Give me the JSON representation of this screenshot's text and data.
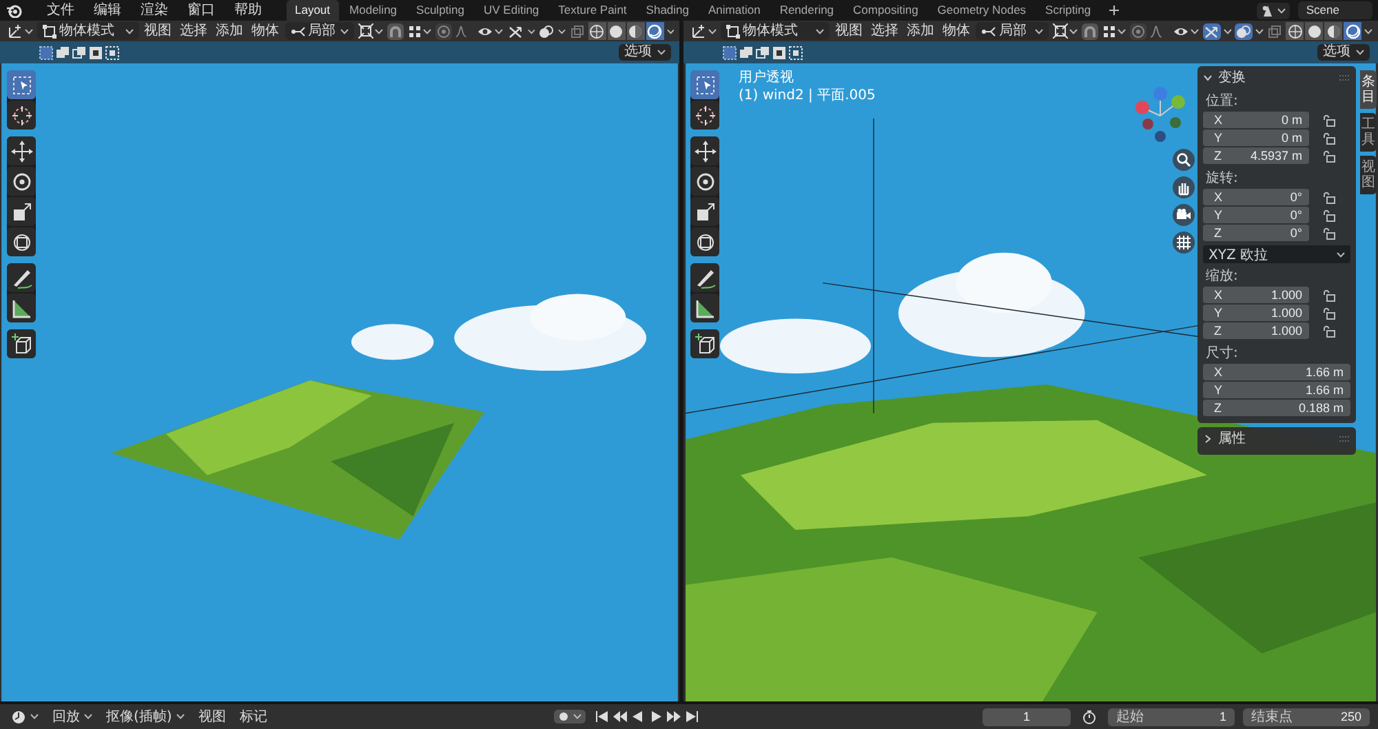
{
  "topbar": {
    "menus": [
      "文件",
      "编辑",
      "渲染",
      "窗口",
      "帮助"
    ],
    "workspaces": [
      {
        "label": "Layout",
        "selected": true
      },
      {
        "label": "Modeling",
        "selected": false
      },
      {
        "label": "Sculpting",
        "selected": false
      },
      {
        "label": "UV Editing",
        "selected": false
      },
      {
        "label": "Texture Paint",
        "selected": false
      },
      {
        "label": "Shading",
        "selected": false
      },
      {
        "label": "Animation",
        "selected": false
      },
      {
        "label": "Rendering",
        "selected": false
      },
      {
        "label": "Compositing",
        "selected": false
      },
      {
        "label": "Geometry Nodes",
        "selected": false
      },
      {
        "label": "Scripting",
        "selected": false
      }
    ],
    "scene": "Scene"
  },
  "viewports": [
    {
      "header": {
        "mode": "物体模式",
        "menus": [
          "视图",
          "选择",
          "添加",
          "物体"
        ],
        "pivot": "局部",
        "gizmos": false,
        "overlays": false,
        "shading": [
          {
            "kind": "wireframe",
            "selected": false
          },
          {
            "kind": "solid",
            "selected": false
          },
          {
            "kind": "material",
            "selected": false
          },
          {
            "kind": "rendered",
            "selected": true
          }
        ]
      },
      "options": "选项",
      "tool_groups": [
        [
          {
            "kind": "select",
            "selected": true
          },
          {
            "kind": "cursor",
            "selected": false
          }
        ],
        [
          {
            "kind": "move",
            "selected": false
          },
          {
            "kind": "rotate",
            "selected": false
          },
          {
            "kind": "scale",
            "selected": false
          },
          {
            "kind": "transform",
            "selected": false
          }
        ],
        [
          {
            "kind": "annotate",
            "selected": false
          },
          {
            "kind": "measure",
            "selected": false
          }
        ],
        [
          {
            "kind": "add",
            "selected": false
          }
        ]
      ]
    },
    {
      "header": {
        "mode": "物体模式",
        "menus": [
          "视图",
          "选择",
          "添加",
          "物体"
        ],
        "pivot": "局部",
        "gizmos": true,
        "overlays": true,
        "shading": [
          {
            "kind": "wireframe",
            "selected": false
          },
          {
            "kind": "solid",
            "selected": false
          },
          {
            "kind": "material",
            "selected": false
          },
          {
            "kind": "rendered",
            "selected": true
          }
        ]
      },
      "options": "选项",
      "tool_groups": [
        [
          {
            "kind": "select",
            "selected": true
          },
          {
            "kind": "cursor",
            "selected": false
          }
        ],
        [
          {
            "kind": "move",
            "selected": false
          },
          {
            "kind": "rotate",
            "selected": false
          },
          {
            "kind": "scale",
            "selected": false
          },
          {
            "kind": "transform",
            "selected": false
          }
        ],
        [
          {
            "kind": "annotate",
            "selected": false
          },
          {
            "kind": "measure",
            "selected": false
          }
        ],
        [
          {
            "kind": "add",
            "selected": false
          }
        ]
      ],
      "info": [
        "用户透视",
        "(1) wind2 | 平面.005"
      ],
      "sidebar": {
        "tabs": [
          {
            "label": "条目",
            "selected": true
          },
          {
            "label": "工具",
            "selected": false
          },
          {
            "label": "视图",
            "selected": false
          }
        ],
        "panels": [
          {
            "title": "变换",
            "expanded": true,
            "groups": [
              {
                "kind": "locked",
                "label": "位置:",
                "fields": [
                  {
                    "axis": "X",
                    "value": "0 m"
                  },
                  {
                    "axis": "Y",
                    "value": "0 m"
                  },
                  {
                    "axis": "Z",
                    "value": "4.5937 m"
                  }
                ]
              },
              {
                "kind": "locked",
                "label": "旋转:",
                "fields": [
                  {
                    "axis": "X",
                    "value": "0°"
                  },
                  {
                    "axis": "Y",
                    "value": "0°"
                  },
                  {
                    "axis": "Z",
                    "value": "0°"
                  }
                ]
              },
              {
                "kind": "dropdown",
                "value": "XYZ 欧拉"
              },
              {
                "kind": "locked",
                "label": "缩放:",
                "fields": [
                  {
                    "axis": "X",
                    "value": "1.000"
                  },
                  {
                    "axis": "Y",
                    "value": "1.000"
                  },
                  {
                    "axis": "Z",
                    "value": "1.000"
                  }
                ]
              },
              {
                "kind": "plain",
                "label": "尺寸:",
                "fields": [
                  {
                    "axis": "X",
                    "value": "1.66 m"
                  },
                  {
                    "axis": "Y",
                    "value": "1.66 m"
                  },
                  {
                    "axis": "Z",
                    "value": "0.188 m"
                  }
                ]
              }
            ]
          },
          {
            "title": "属性",
            "expanded": false
          }
        ]
      }
    }
  ],
  "timeline": {
    "menus": [
      {
        "label": "回放",
        "dropdown": true
      },
      {
        "label": "抠像(插帧)",
        "dropdown": true
      },
      {
        "label": "视图",
        "dropdown": false
      },
      {
        "label": "标记",
        "dropdown": false
      }
    ],
    "current_frame": "1",
    "start_label": "起始",
    "start": "1",
    "end_label": "结束点",
    "end": "250"
  }
}
